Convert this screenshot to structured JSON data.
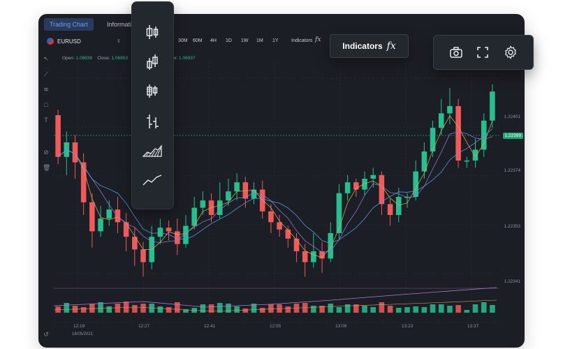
{
  "tabs": {
    "active": "Trading Chart",
    "second": "Information"
  },
  "toolbar": {
    "symbol": "EURUSD",
    "timeframes": [
      "30M",
      "60M",
      "4H",
      "1D",
      "1W",
      "1M",
      "1Y"
    ],
    "indicators_label": "Indicators",
    "fx_symbol": "fx"
  },
  "ohlc": {
    "open_label": "Open:",
    "open_value": "1.06939",
    "close_label": "Close:",
    "close_value": "1.06953",
    "low_label": "ow:",
    "low_value": "1.06937"
  },
  "price_axis": {
    "labels": [
      "1.22401",
      "1.22374",
      "1.22353",
      "1.22341"
    ],
    "current_price": "1.22399"
  },
  "time_axis": {
    "labels": [
      "12:19",
      "12:27",
      "12:41",
      "12:55",
      "13:09",
      "13:23",
      "13:37"
    ],
    "date": "18/05/2021"
  },
  "chart_type_panel": {
    "items": [
      "candles-icon",
      "hollow-candles-icon",
      "heikin-ashi-icon",
      "bars-icon",
      "area-icon",
      "line-icon"
    ]
  },
  "indicators_button": {
    "label": "Indicators",
    "fx": "fx"
  },
  "icon_bar": {
    "items": [
      "camera-icon",
      "fullscreen-icon",
      "settings-icon"
    ]
  },
  "colors": {
    "up": "#26c08f",
    "down": "#ef5b5b",
    "background": "#1b1e24",
    "panel": "#23272e",
    "accent": "#6f9bea"
  },
  "chart_data": {
    "type": "candlestick",
    "candles": [
      {
        "o": 95,
        "c": 72,
        "h": 98,
        "l": 68
      },
      {
        "o": 72,
        "c": 80,
        "h": 86,
        "l": 62
      },
      {
        "o": 80,
        "c": 69,
        "h": 84,
        "l": 60
      },
      {
        "o": 69,
        "c": 47,
        "h": 74,
        "l": 40
      },
      {
        "o": 47,
        "c": 31,
        "h": 52,
        "l": 22
      },
      {
        "o": 31,
        "c": 38,
        "h": 45,
        "l": 28
      },
      {
        "o": 38,
        "c": 43,
        "h": 48,
        "l": 34
      },
      {
        "o": 43,
        "c": 36,
        "h": 50,
        "l": 30
      },
      {
        "o": 36,
        "c": 28,
        "h": 41,
        "l": 20
      },
      {
        "o": 28,
        "c": 21,
        "h": 33,
        "l": 12
      },
      {
        "o": 21,
        "c": 14,
        "h": 25,
        "l": 6
      },
      {
        "o": 14,
        "c": 28,
        "h": 34,
        "l": 10
      },
      {
        "o": 28,
        "c": 33,
        "h": 38,
        "l": 24
      },
      {
        "o": 33,
        "c": 31,
        "h": 37,
        "l": 26
      },
      {
        "o": 31,
        "c": 24,
        "h": 38,
        "l": 18
      },
      {
        "o": 24,
        "c": 34,
        "h": 40,
        "l": 22
      },
      {
        "o": 34,
        "c": 44,
        "h": 50,
        "l": 32
      },
      {
        "o": 44,
        "c": 48,
        "h": 53,
        "l": 40
      },
      {
        "o": 48,
        "c": 40,
        "h": 52,
        "l": 36
      },
      {
        "o": 40,
        "c": 48,
        "h": 58,
        "l": 38
      },
      {
        "o": 48,
        "c": 53,
        "h": 60,
        "l": 45
      },
      {
        "o": 53,
        "c": 58,
        "h": 63,
        "l": 48
      },
      {
        "o": 58,
        "c": 49,
        "h": 61,
        "l": 44
      },
      {
        "o": 49,
        "c": 54,
        "h": 58,
        "l": 46
      },
      {
        "o": 54,
        "c": 42,
        "h": 59,
        "l": 38
      },
      {
        "o": 42,
        "c": 36,
        "h": 46,
        "l": 30
      },
      {
        "o": 36,
        "c": 32,
        "h": 40,
        "l": 28
      },
      {
        "o": 32,
        "c": 27,
        "h": 34,
        "l": 22
      },
      {
        "o": 27,
        "c": 20,
        "h": 30,
        "l": 14
      },
      {
        "o": 20,
        "c": 14,
        "h": 24,
        "l": 6
      },
      {
        "o": 14,
        "c": 20,
        "h": 30,
        "l": 11
      },
      {
        "o": 20,
        "c": 16,
        "h": 25,
        "l": 8
      },
      {
        "o": 16,
        "c": 30,
        "h": 36,
        "l": 14
      },
      {
        "o": 30,
        "c": 52,
        "h": 57,
        "l": 27
      },
      {
        "o": 52,
        "c": 58,
        "h": 62,
        "l": 48
      },
      {
        "o": 58,
        "c": 54,
        "h": 60,
        "l": 50
      },
      {
        "o": 54,
        "c": 60,
        "h": 64,
        "l": 51
      },
      {
        "o": 60,
        "c": 62,
        "h": 66,
        "l": 55
      },
      {
        "o": 62,
        "c": 46,
        "h": 64,
        "l": 40
      },
      {
        "o": 46,
        "c": 40,
        "h": 49,
        "l": 34
      },
      {
        "o": 40,
        "c": 50,
        "h": 55,
        "l": 36
      },
      {
        "o": 50,
        "c": 50,
        "h": 52,
        "l": 44
      },
      {
        "o": 50,
        "c": 64,
        "h": 70,
        "l": 48
      },
      {
        "o": 64,
        "c": 75,
        "h": 80,
        "l": 60
      },
      {
        "o": 75,
        "c": 88,
        "h": 92,
        "l": 72
      },
      {
        "o": 88,
        "c": 96,
        "h": 104,
        "l": 84
      },
      {
        "o": 96,
        "c": 100,
        "h": 110,
        "l": 90
      },
      {
        "o": 100,
        "c": 70,
        "h": 104,
        "l": 66
      },
      {
        "o": 70,
        "c": 70,
        "h": 72,
        "l": 66
      },
      {
        "o": 70,
        "c": 76,
        "h": 82,
        "l": 66
      },
      {
        "o": 76,
        "c": 92,
        "h": 96,
        "l": 72
      },
      {
        "o": 92,
        "c": 108,
        "h": 112,
        "l": 88
      }
    ],
    "ylim": [
      0,
      120
    ]
  }
}
